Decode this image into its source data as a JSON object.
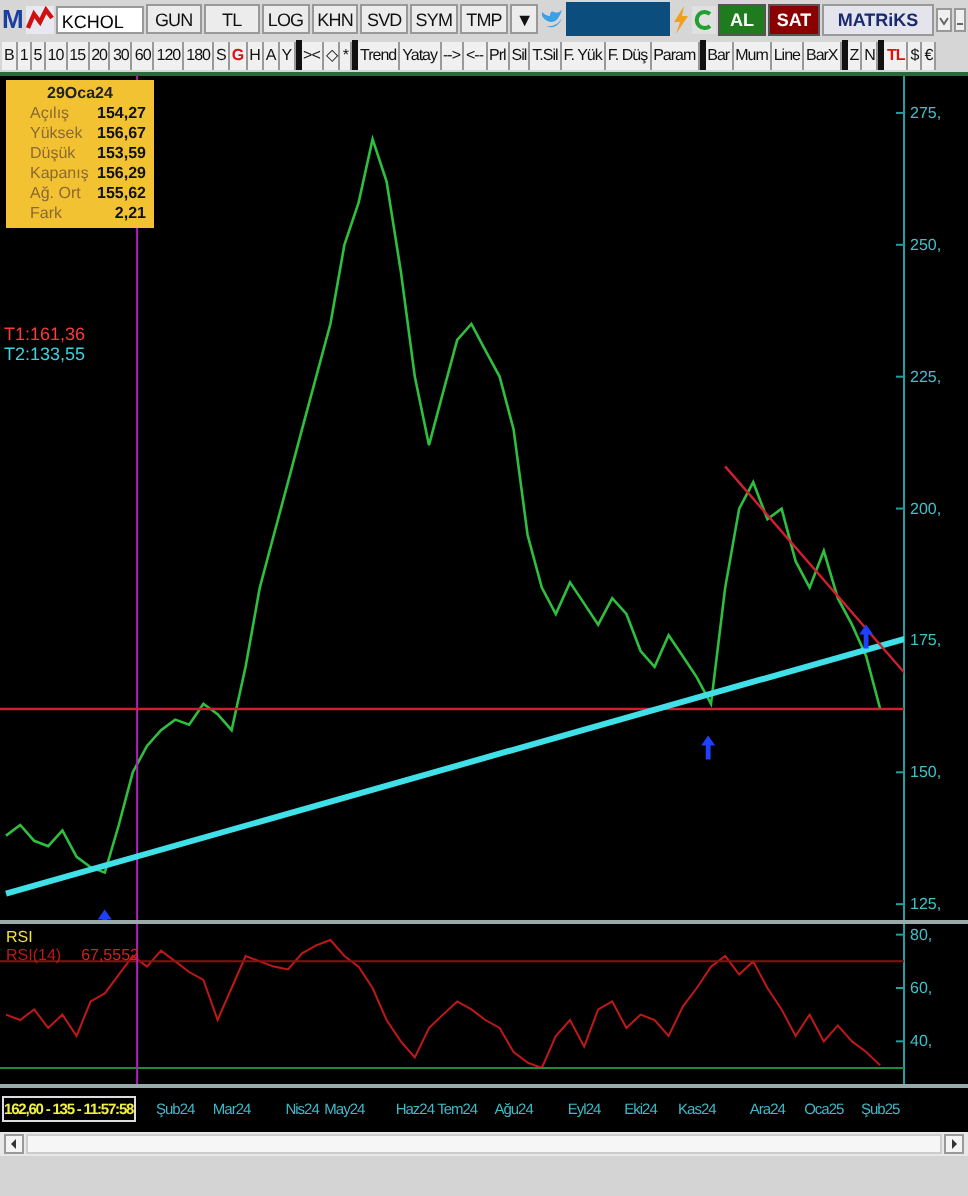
{
  "top_toolbar": {
    "logo": "M",
    "symbol": "KCHOL",
    "buttons": [
      {
        "label": "GUN",
        "kind": "wide"
      },
      {
        "label": "TL",
        "kind": "wide"
      },
      {
        "label": "LOG",
        "kind": "button"
      },
      {
        "label": "KHN",
        "kind": "button"
      },
      {
        "label": "SVD",
        "kind": "button"
      },
      {
        "label": "SYM",
        "kind": "button"
      },
      {
        "label": "TMP",
        "kind": "button"
      },
      {
        "label": "▼",
        "kind": "button"
      }
    ],
    "buy": "AL",
    "sell": "SAT",
    "brand": "MATRiKS"
  },
  "bottom_toolbar": [
    {
      "label": "B",
      "kind": "button",
      "selected": false
    },
    {
      "label": "1",
      "kind": "button",
      "selected": false
    },
    {
      "label": "5",
      "kind": "button",
      "selected": false
    },
    {
      "label": "10",
      "kind": "button",
      "selected": false
    },
    {
      "label": "15",
      "kind": "button",
      "selected": false
    },
    {
      "label": "20",
      "kind": "button",
      "selected": false
    },
    {
      "label": "30",
      "kind": "button",
      "selected": false
    },
    {
      "label": "60",
      "kind": "button",
      "selected": false
    },
    {
      "label": "120",
      "kind": "button",
      "selected": false
    },
    {
      "label": "180",
      "kind": "button",
      "selected": false
    },
    {
      "label": "S",
      "kind": "button",
      "selected": false
    },
    {
      "label": "G",
      "kind": "button",
      "selected": true
    },
    {
      "label": "H",
      "kind": "button",
      "selected": false
    },
    {
      "label": "A",
      "kind": "button",
      "selected": false
    },
    {
      "label": "Y",
      "kind": "button",
      "selected": false
    },
    {
      "kind": "separator"
    },
    {
      "label": "><",
      "kind": "button",
      "selected": false
    },
    {
      "label": "◇",
      "kind": "button",
      "selected": false
    },
    {
      "label": "*",
      "kind": "button",
      "selected": false
    },
    {
      "kind": "separator"
    },
    {
      "label": "Trend",
      "kind": "button",
      "selected": false
    },
    {
      "label": "Yatay",
      "kind": "button",
      "selected": false
    },
    {
      "label": "-->",
      "kind": "button",
      "selected": false
    },
    {
      "label": "<--",
      "kind": "button",
      "selected": false
    },
    {
      "label": "Prl",
      "kind": "button",
      "selected": false
    },
    {
      "label": "Sil",
      "kind": "button",
      "selected": false
    },
    {
      "label": "T.Sil",
      "kind": "button",
      "selected": false
    },
    {
      "label": "F. Yük",
      "kind": "button",
      "selected": false
    },
    {
      "label": "F. Düş",
      "kind": "button",
      "selected": false
    },
    {
      "label": "Param",
      "kind": "button",
      "selected": false
    },
    {
      "kind": "separator"
    },
    {
      "label": "Bar",
      "kind": "button",
      "selected": false
    },
    {
      "label": "Mum",
      "kind": "button",
      "selected": false
    },
    {
      "label": "Line",
      "kind": "button",
      "selected": false
    },
    {
      "label": "BarX",
      "kind": "button",
      "selected": false
    },
    {
      "kind": "separator"
    },
    {
      "label": "Z",
      "kind": "button",
      "selected": false
    },
    {
      "label": "N",
      "kind": "button",
      "selected": false
    },
    {
      "kind": "separator"
    },
    {
      "label": "TL",
      "kind": "button",
      "selected": true
    },
    {
      "label": "$",
      "kind": "button",
      "selected": false
    },
    {
      "label": "€",
      "kind": "button",
      "selected": false
    }
  ],
  "info_box": {
    "date": "29Oca24",
    "rows": [
      {
        "label": "Açılış",
        "value": "154,27"
      },
      {
        "label": "Yüksek",
        "value": "156,67"
      },
      {
        "label": "Düşük",
        "value": "153,59"
      },
      {
        "label": "Kapanış",
        "value": "156,29"
      },
      {
        "label": "Ağ. Ort",
        "value": "155,62"
      },
      {
        "label": "Fark",
        "value": "2,21"
      }
    ]
  },
  "price_panel": {
    "t1": "T1:161,36",
    "t2": "T2:133,55",
    "chart_data": {
      "type": "line",
      "series": [
        {
          "color": "#2fbf3f",
          "values": [
            138,
            140,
            137,
            136,
            139,
            134,
            132,
            131,
            140,
            150,
            155,
            158,
            160,
            159,
            163,
            161,
            158,
            170,
            185,
            195,
            205,
            215,
            225,
            235,
            250,
            258,
            270,
            262,
            245,
            225,
            212,
            222,
            232,
            235,
            230,
            225,
            215,
            195,
            185,
            180,
            186,
            182,
            178,
            183,
            180,
            173,
            170,
            176,
            172,
            168,
            163,
            185,
            200,
            205,
            198,
            200,
            190,
            185,
            192,
            183,
            178,
            172,
            162
          ]
        }
      ],
      "ylim": [
        122,
        282
      ],
      "yticks": [
        {
          "value": 275,
          "label": "275,"
        },
        {
          "value": 250,
          "label": "250,"
        },
        {
          "value": 225,
          "label": "225,"
        },
        {
          "value": 200,
          "label": "200,"
        },
        {
          "value": 175,
          "label": "175,"
        },
        {
          "value": 150,
          "label": "150,"
        },
        {
          "value": 125,
          "label": "125,"
        }
      ]
    }
  },
  "rsi_panel": {
    "title": "RSI",
    "reading": "67,5552",
    "chart_data": {
      "type": "line",
      "categories": [
        null,
        null,
        null,
        null,
        null,
        null,
        null,
        null,
        null,
        null,
        null,
        null,
        "Şub24",
        null,
        null,
        null,
        "Mar24",
        null,
        null,
        null,
        null,
        "Nis24",
        null,
        null,
        "May24",
        null,
        null,
        null,
        null,
        "Haz24",
        null,
        null,
        "Tem24",
        null,
        null,
        null,
        "Ağu24",
        null,
        null,
        null,
        null,
        "Eyl24",
        null,
        null,
        null,
        "Eki24",
        null,
        null,
        null,
        "Kas24",
        null,
        null,
        null,
        null,
        "Ara24",
        null,
        null,
        null,
        "Oca25",
        null,
        null,
        null,
        "Şub25"
      ],
      "series": [
        {
          "name": "RSI(14)",
          "color": "#c01818",
          "values": [
            50,
            48,
            52,
            45,
            50,
            42,
            55,
            58,
            65,
            72,
            68,
            74,
            70,
            66,
            63,
            48,
            60,
            72,
            70,
            68,
            67,
            73,
            76,
            78,
            72,
            68,
            60,
            48,
            40,
            34,
            45,
            50,
            55,
            52,
            48,
            45,
            36,
            32,
            30,
            42,
            48,
            38,
            52,
            55,
            45,
            50,
            48,
            42,
            53,
            60,
            68,
            72,
            65,
            70,
            60,
            52,
            42,
            50,
            40,
            46,
            40,
            36,
            31
          ]
        }
      ],
      "ylim": [
        24,
        84
      ],
      "yticks": [
        {
          "value": 80,
          "label": "80,"
        },
        {
          "value": 60,
          "label": "60,"
        },
        {
          "value": 40,
          "label": "40,"
        }
      ],
      "ref_lines": [
        {
          "axis": "y",
          "value": 70,
          "color": "#8a1010"
        },
        {
          "axis": "y",
          "value": 30,
          "color": "#1e8a3a"
        }
      ]
    }
  },
  "status": "162,60 - 135 - 11:57:58"
}
